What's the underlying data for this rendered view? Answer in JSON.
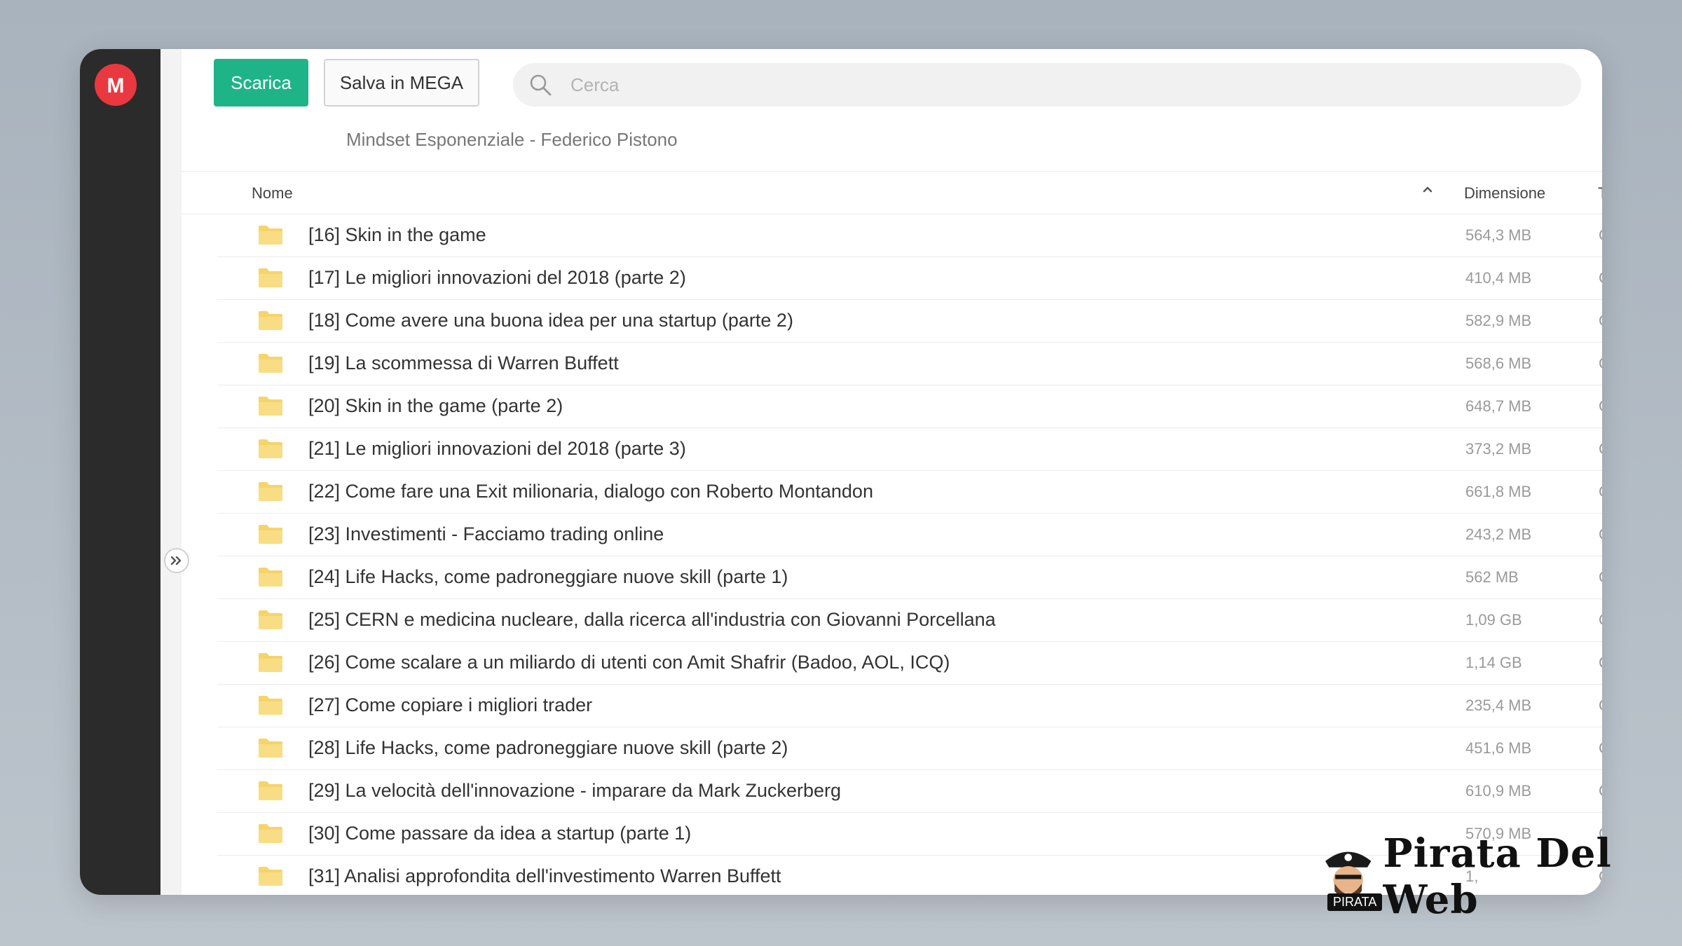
{
  "app": {
    "logo_letter": "M"
  },
  "toolbar": {
    "download_label": "Scarica",
    "save_label": "Salva in MEGA"
  },
  "search": {
    "placeholder": "Cerca"
  },
  "breadcrumb": "Mindset Esponenziale - Federico Pistono",
  "columns": {
    "name": "Nome",
    "size": "Dimensione",
    "type": "Tipo"
  },
  "rows": [
    {
      "name": "[16] Skin in the game",
      "size": "564,3 MB",
      "type": "Cartella"
    },
    {
      "name": "[17] Le migliori innovazioni del 2018 (parte 2)",
      "size": "410,4 MB",
      "type": "Cartella"
    },
    {
      "name": "[18] Come avere una buona idea per una startup (parte 2)",
      "size": "582,9 MB",
      "type": "Cartella"
    },
    {
      "name": "[19] La scommessa di Warren Buffett",
      "size": "568,6 MB",
      "type": "Cartella"
    },
    {
      "name": "[20] Skin in the game (parte 2)",
      "size": "648,7 MB",
      "type": "Cartella"
    },
    {
      "name": "[21] Le migliori innovazioni del 2018 (parte 3)",
      "size": "373,2 MB",
      "type": "Cartella"
    },
    {
      "name": "[22] Come fare una Exit milionaria, dialogo con Roberto Montandon",
      "size": "661,8 MB",
      "type": "Cartella"
    },
    {
      "name": "[23] Investimenti - Facciamo trading online",
      "size": "243,2 MB",
      "type": "Cartella"
    },
    {
      "name": "[24] Life Hacks, come padroneggiare nuove skill (parte 1)",
      "size": "562 MB",
      "type": "Cartella"
    },
    {
      "name": "[25] CERN e medicina nucleare, dalla ricerca all'industria con Giovanni Porcellana",
      "size": "1,09 GB",
      "type": "Cartella"
    },
    {
      "name": "[26] Come scalare a un miliardo di utenti con Amit Shafrir (Badoo, AOL, ICQ)",
      "size": "1,14 GB",
      "type": "Cartella"
    },
    {
      "name": "[27] Come copiare i migliori trader",
      "size": "235,4 MB",
      "type": "Cartella"
    },
    {
      "name": "[28] Life Hacks, come padroneggiare nuove skill (parte 2)",
      "size": "451,6 MB",
      "type": "Cartella"
    },
    {
      "name": "[29] La velocità dell'innovazione - imparare da Mark Zuckerberg",
      "size": "610,9 MB",
      "type": "Cartella"
    },
    {
      "name": "[30] Come passare da idea a startup (parte 1)",
      "size": "570,9 MB",
      "type": "Cartella"
    },
    {
      "name": "[31] Analisi approfondita dell'investimento Warren Buffett",
      "size": "1,",
      "type": "Cartella"
    }
  ],
  "watermark": {
    "text": "Pirata Del Web",
    "badge": "PIRATA"
  },
  "colors": {
    "accent": "#1fb487",
    "brand": "#e9383f",
    "folder": "#f6d36b"
  }
}
